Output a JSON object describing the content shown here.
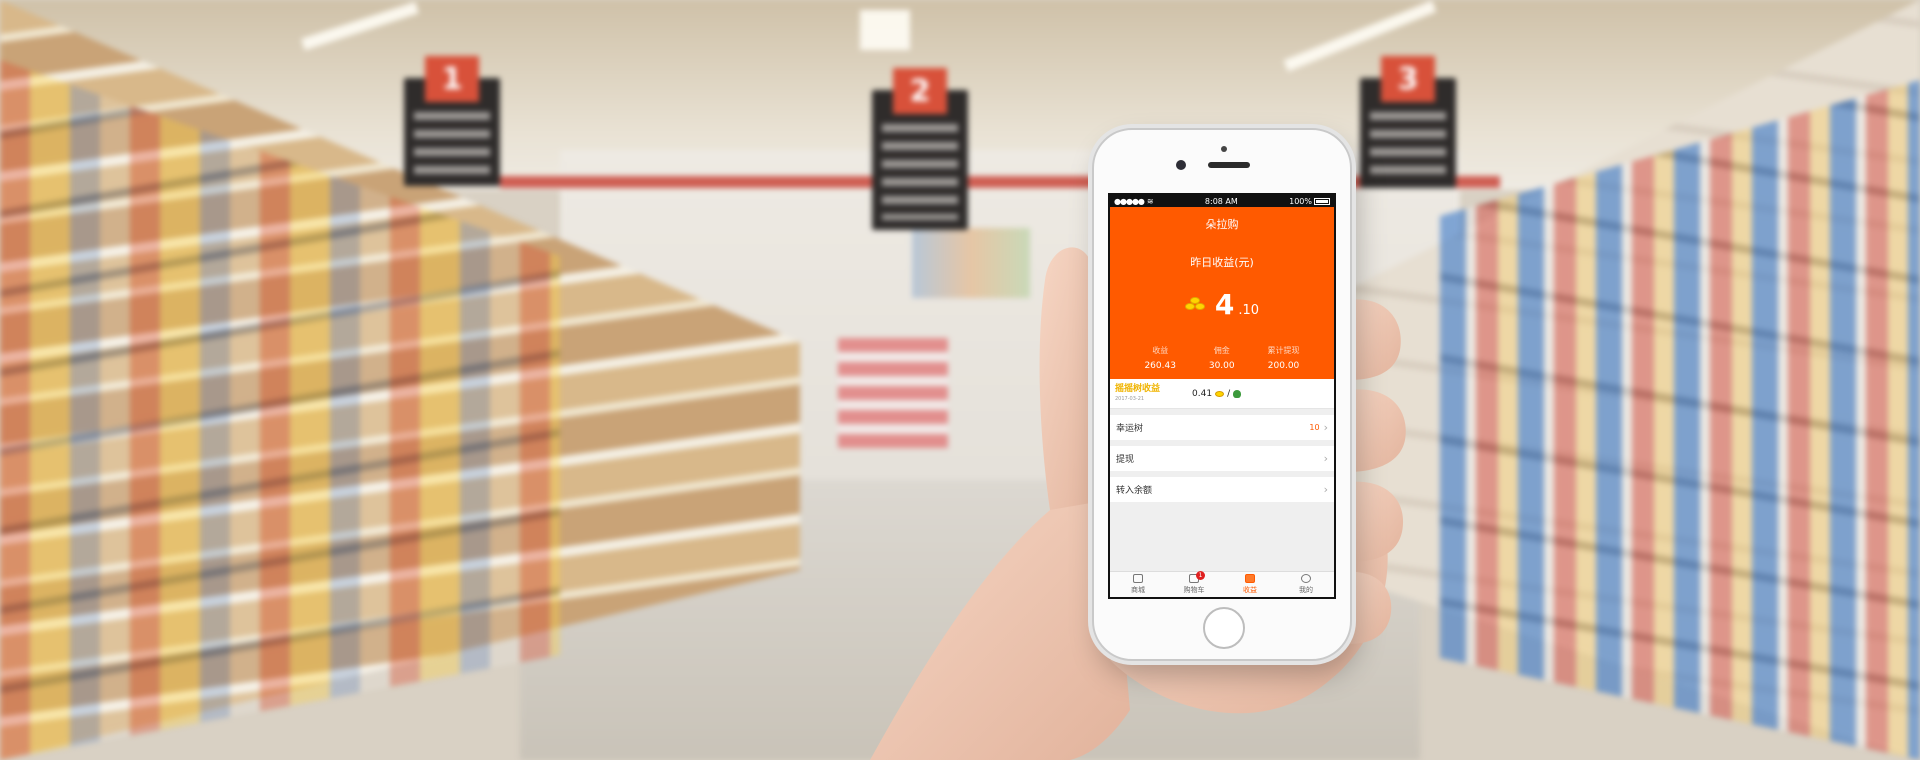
{
  "statusbar": {
    "signal": "●●●●●",
    "time": "8:08 AM",
    "battery": "100%"
  },
  "app": {
    "title": "朵拉购"
  },
  "earnings": {
    "label": "昨日收益(元)",
    "value_int": "4",
    "value_dec": ".10",
    "icon": "coins-icon"
  },
  "stats": [
    {
      "label": "收益",
      "value": "260.43"
    },
    {
      "label": "佣金",
      "value": "30.00"
    },
    {
      "label": "累计提现",
      "value": "200.00"
    }
  ],
  "tree_income": {
    "label": "摇摇树收益",
    "date": "2017-03-21",
    "rate": "0.41",
    "separator": "/"
  },
  "menu": [
    {
      "label": "幸运树",
      "count": "10"
    },
    {
      "label": "提现",
      "count": ""
    },
    {
      "label": "转入余额",
      "count": ""
    }
  ],
  "tabs": [
    {
      "label": "商城",
      "icon": "shop-icon"
    },
    {
      "label": "购物车",
      "icon": "cart-icon",
      "badge": "1"
    },
    {
      "label": "收益",
      "icon": "earnings-icon",
      "active": true
    },
    {
      "label": "我的",
      "icon": "profile-icon"
    }
  ],
  "background": {
    "aisle_signs": [
      "1",
      "2",
      "3"
    ]
  },
  "colors": {
    "accent": "#ff5a00",
    "gold": "#f0b400"
  }
}
